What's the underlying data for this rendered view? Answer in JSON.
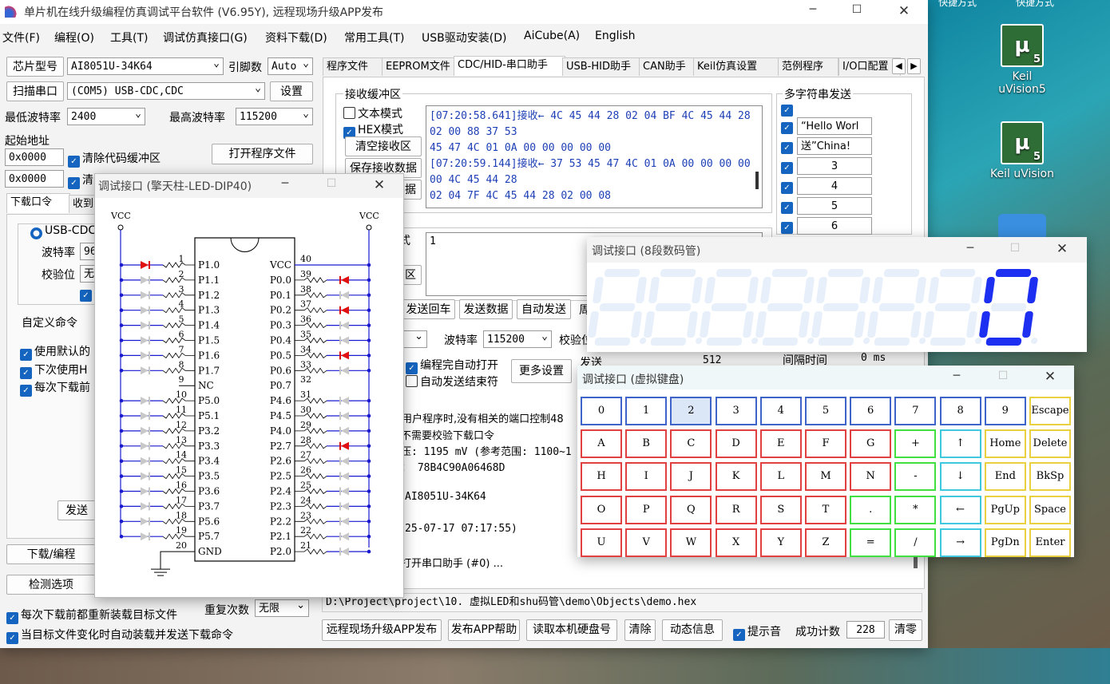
{
  "desktop": {
    "icons": [
      {
        "label": "Keil uVision5",
        "line1": "Keil",
        "line2": "uVision5"
      },
      {
        "label": "Keil uVision",
        "line1": "Keil uVision",
        "line2": ""
      }
    ],
    "top_labels": [
      "快捷方式",
      "快捷方式"
    ]
  },
  "main": {
    "title": "单片机在线升级编程仿真调试平台软件 (V6.95Y), 远程现场升级APP发布",
    "menu": [
      "文件(F)",
      "编程(O)",
      "工具(T)",
      "调试仿真接口(G)",
      "资料下载(D)",
      "常用工具(T)",
      "USB驱动安装(D)",
      "AiCube(A)",
      "English"
    ],
    "chip_btn": "芯片型号",
    "chip_val": "AI8051U-34K64",
    "pin_label": "引脚数",
    "pin_val": "Auto",
    "scan_btn": "扫描串口",
    "port_val": "(COM5) USB-CDC,CDC",
    "settings_btn": "设置",
    "min_baud_label": "最低波特率",
    "min_baud": "2400",
    "max_baud_label": "最高波特率",
    "max_baud": "115200",
    "start_addr_label": "起始地址",
    "addr1": "0x0000",
    "addr2": "0x0000",
    "clear_code": "清除代码缓冲区",
    "clear_cut": "清",
    "open_prog_btn": "打开程序文件",
    "left_tabs": [
      "下载口令",
      "收到"
    ],
    "usb_cdc": "USB-CDC/",
    "baud_label": "波特率",
    "baud_cut": "96",
    "parity_label": "校验位",
    "parity_cut": "无",
    "custom_cmd": "自定义命令",
    "opt1": "使用默认的",
    "opt2": "下次使用H",
    "opt3": "每次下载前",
    "send_cut": "发送",
    "download_btn": "下载/编程",
    "detect_btn": "检测选项",
    "reload_opt": "每次下载前都重新装载目标文件",
    "repeat_label": "重复次数",
    "repeat_val": "无限",
    "auto_reload_opt": "当目标文件变化时自动装载并发送下载命令",
    "right_tabs": [
      "程序文件",
      "EEPROM文件",
      "CDC/HID-串口助手",
      "USB-HID助手",
      "CAN助手",
      "Keil仿真设置",
      "范例程序",
      "I/O口配置"
    ],
    "rx_group": "接收缓冲区",
    "text_mode": "文本模式",
    "hex_mode": "HEX模式",
    "clear_rx_btn": "清空接收区",
    "save_rx_btn": "保存接收数据",
    "save_cut": "据",
    "rx_lines": [
      "[07:20:58.641]接收← 4C 45 44 28 02 04 BF 4C 45 44 28",
      "02 00 88 37 53",
      "45 47 4C 01 0A 00 00 00 00 00",
      "[07:20:59.144]接收← 37 53 45 47 4C 01 0A 00 00 00 00",
      "00 4C 45 44 28",
      "02 04 7F 4C 45 44 28 02 00 08"
    ],
    "multi_title": "多字符串发送",
    "multi_items": [
      "“Hello Worl",
      "送”China!",
      "3",
      "4",
      "5",
      "6"
    ],
    "tx_cut": "式",
    "tx_val": "1",
    "tx_btn_cut": "区",
    "send_echo": "发送回车",
    "send_data": "发送数据",
    "auto_send": "自动发送",
    "cut_ce": "周",
    "baud2_label": "波特率",
    "baud2_val": "115200",
    "parity2_cut": "校验位",
    "auto_open": "编程完自动打开",
    "auto_end": "自动发送结束符",
    "more_settings": "更多设置",
    "send_label": "发送",
    "send_count": "512",
    "interval_label": "间隔时间",
    "interval_val": "0 ms",
    "log_lines": [
      "户用户程序时,没有相关的端口控制48",
      "不需要校验下载口令",
      "压: 1195 mV (参考范围: 1100~1",
      "： 78B4C90A06468D",
      "",
      "AI8051U-34K64",
      "",
      "25-07-17 07:17:55)",
      "",
      "打开串口助手 (#0) ..."
    ],
    "path": "D:\\Project\\project\\10. 虚拟LED和shu码管\\demo\\Objects\\demo.hex",
    "bottom_btns": [
      "远程现场升级APP发布",
      "发布APP帮助",
      "读取本机硬盘号",
      "清除",
      "动态信息"
    ],
    "beep": "提示音",
    "success_label": "成功计数",
    "success_val": "228",
    "clear_count": "清零"
  },
  "led": {
    "title": "调试接口 (擎天柱-LED-DIP40)",
    "vcc": "VCC",
    "gnd": "GND",
    "left_pins": [
      "P1.0",
      "P1.1",
      "P1.2",
      "P1.3",
      "P1.4",
      "P1.5",
      "P1.6",
      "P1.7",
      "NC",
      "P5.0",
      "P5.1",
      "P3.2",
      "P3.3",
      "P3.4",
      "P3.5",
      "P3.6",
      "P3.7",
      "P5.6",
      "P5.7",
      "GND"
    ],
    "right_pins": [
      "VCC",
      "P0.0",
      "P0.1",
      "P0.2",
      "P0.3",
      "P0.4",
      "P0.5",
      "P0.6",
      "P0.7",
      "P4.6",
      "P4.5",
      "P4.0",
      "P2.7",
      "P2.6",
      "P2.5",
      "P2.4",
      "P2.3",
      "P2.2",
      "P2.1",
      "P2.0"
    ],
    "left_lit": [
      1,
      0,
      0,
      0,
      0,
      0,
      0,
      0,
      0,
      0,
      0,
      0,
      0,
      0,
      0,
      0,
      0,
      0,
      0,
      0
    ],
    "right_lit": [
      0,
      1,
      0,
      1,
      0,
      0,
      1,
      0,
      1,
      0,
      0,
      0,
      1,
      0,
      0,
      0,
      0,
      0,
      0,
      0
    ],
    "colors": {
      "lit": "#e01010",
      "off": "#c8c8c8",
      "wire": "#1a1ad0"
    }
  },
  "seg": {
    "title": "调试接口 (8段数码管)",
    "digits": [
      "",
      "",
      "",
      "",
      "",
      "",
      "",
      "0"
    ]
  },
  "kbd": {
    "title": "调试接口 (虚拟键盘)",
    "rows": [
      [
        "0",
        "1",
        "2",
        "3",
        "4",
        "5",
        "6",
        "7",
        "8",
        "9",
        "Escape"
      ],
      [
        "A",
        "B",
        "C",
        "D",
        "E",
        "F",
        "G",
        "+",
        "↑",
        "Home",
        "Delete"
      ],
      [
        "H",
        "I",
        "J",
        "K",
        "L",
        "M",
        "N",
        "-",
        "↓",
        "End",
        "BkSp"
      ],
      [
        "O",
        "P",
        "Q",
        "R",
        "S",
        "T",
        ".",
        "*",
        "←",
        "PgUp",
        "Space"
      ],
      [
        "U",
        "V",
        "W",
        "X",
        "Y",
        "Z",
        "=",
        "/",
        "→",
        "PgDn",
        "Enter"
      ]
    ],
    "selected": "2"
  }
}
